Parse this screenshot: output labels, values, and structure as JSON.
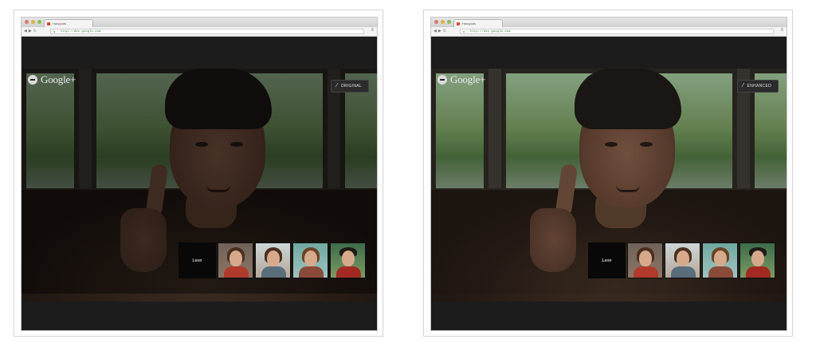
{
  "brand": {
    "name": "Google+"
  },
  "browser": {
    "tab_title": "Hangouts",
    "url": "http://dev.google.com"
  },
  "panels": [
    {
      "effect_label": "Original",
      "self_label": "Leon"
    },
    {
      "effect_label": "Enhanced",
      "self_label": "Leon"
    }
  ],
  "icons": [
    "google-plus-icon",
    "magic-wand-icon",
    "lock-icon",
    "wrench-icon",
    "back-icon",
    "forward-icon",
    "reload-icon"
  ]
}
